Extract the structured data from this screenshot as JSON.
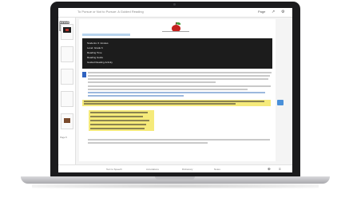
{
  "window": {
    "title": "To Pursue or Not to Pursue: A Guided Reading"
  },
  "topbar": {
    "page_indicator": "Page",
    "share_icon": "share-icon",
    "settings_icon": "settings-icon"
  },
  "sidebar": {
    "items": [
      {
        "label": "Page 1"
      },
      {
        "label": "Page 2"
      },
      {
        "label": "Page 3"
      },
      {
        "label": "Page 4"
      },
      {
        "label": "Page 5"
      }
    ]
  },
  "document": {
    "darkbox_lines": [
      "Students: 6 minutes",
      "Level: Grade 6",
      "Reading Time",
      "Reading Guide",
      "Guided Reading Activity"
    ]
  },
  "bottombar": {
    "items": [
      "Text to Speech",
      "Annotations",
      "Dictionary",
      "Notes"
    ],
    "zoom_icon": "zoom-icon",
    "menu_icon": "menu-icon"
  },
  "colors": {
    "laptop_frame": "#1b1b1d",
    "highlight": "#f5ea7a",
    "accent_blue": "#2f62c0",
    "brand_red": "#c4221f"
  }
}
